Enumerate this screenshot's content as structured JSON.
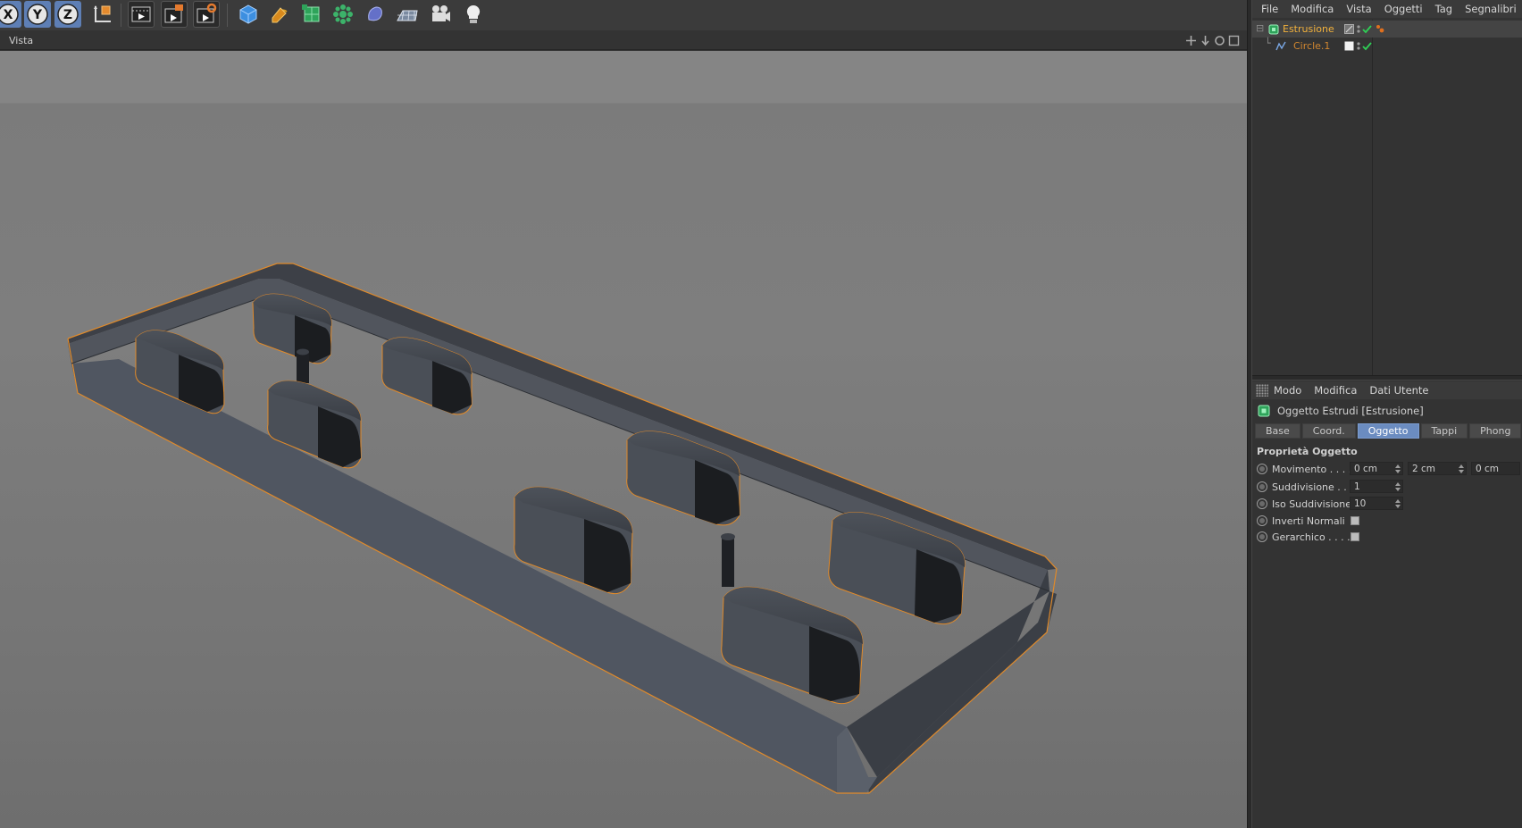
{
  "toolbar": {
    "axis_x": "X",
    "axis_y": "Y",
    "axis_z": "Z",
    "icons": [
      "axis-x-icon",
      "axis-y-icon",
      "axis-z-icon",
      "coordinate-system-icon",
      "render-view-icon",
      "render-picture-viewer-icon",
      "render-settings-icon",
      "cube-primitive-icon",
      "pen-spline-icon",
      "subdivision-surface-icon",
      "cloner-icon",
      "deformer-icon",
      "floor-icon",
      "camera-icon",
      "light-icon"
    ]
  },
  "viewport": {
    "title": "Vista",
    "selection_color": "#e08a2a",
    "background_color": "#7c7c7c"
  },
  "object_manager": {
    "menu": [
      "File",
      "Modifica",
      "Vista",
      "Oggetti",
      "Tag",
      "Segnalibri"
    ],
    "objects": [
      {
        "name": "Estrusione",
        "color": "#f2b13c",
        "icon": "extrude-icon",
        "level": 0
      },
      {
        "name": "Circle.1",
        "color": "#d08630",
        "icon": "spline-circle-icon",
        "level": 1
      }
    ]
  },
  "attribute_manager": {
    "menu": [
      "Modo",
      "Modifica",
      "Dati Utente"
    ],
    "title": "Oggetto Estrudi [Estrusione]",
    "tabs": [
      {
        "label": "Base",
        "active": false
      },
      {
        "label": "Coord.",
        "active": false
      },
      {
        "label": "Oggetto",
        "active": true
      },
      {
        "label": "Tappi",
        "active": false
      },
      {
        "label": "Phong",
        "active": false
      }
    ],
    "section": "Proprietà Oggetto",
    "props": {
      "movimento": {
        "label": "Movimento . . . .",
        "x": "0 cm",
        "y": "2 cm",
        "z": "0 cm"
      },
      "suddivisione": {
        "label": "Suddivisione . . .",
        "value": "1"
      },
      "iso": {
        "label": "Iso Suddivisione",
        "value": "10"
      },
      "inverti": {
        "label": "Inverti Normali",
        "checked": false
      },
      "gerarchico": {
        "label": "Gerarchico . . . . .",
        "checked": false
      }
    },
    "active_tab_color": "#6b8cc0"
  }
}
